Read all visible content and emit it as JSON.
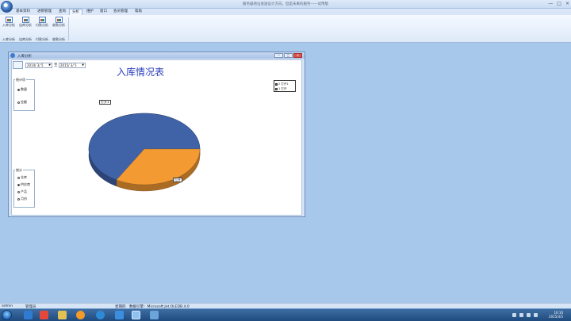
{
  "window": {
    "title": "服务器地址发送设计方向，但是未来的服务——试用版",
    "controls": [
      "—",
      "□",
      "×"
    ]
  },
  "menu": {
    "tabs": [
      {
        "label": "基本资料",
        "active": false
      },
      {
        "label": "进销管理",
        "active": false
      },
      {
        "label": "查询",
        "active": false
      },
      {
        "label": "分析",
        "active": true
      },
      {
        "label": "维护",
        "active": false
      },
      {
        "label": "窗口",
        "active": false
      },
      {
        "label": "会员管理",
        "active": false
      },
      {
        "label": "帮助",
        "active": false
      }
    ]
  },
  "ribbon": {
    "buttons": [
      {
        "icon": "chart-icon",
        "label": "入库分析",
        "foot": "入库分析"
      },
      {
        "icon": "chart-icon",
        "label": "出库分析",
        "foot": "出库分析"
      },
      {
        "icon": "chart-icon",
        "label": "付款分析",
        "foot": "付款分析"
      },
      {
        "icon": "chart-icon",
        "label": "收款分析",
        "foot": "收款分析"
      }
    ]
  },
  "child_window": {
    "title": "入库分析",
    "controls": [
      "—",
      "□",
      "×"
    ],
    "date_from": "2014/ 3/ 5",
    "date_to": "2015/ 3/ 5",
    "to_label": "至",
    "chart_title": "入库情况表",
    "group_stat": {
      "label": "统计项",
      "options": [
        {
          "label": "数量",
          "selected": true
        },
        {
          "label": "金额",
          "selected": false
        }
      ]
    },
    "group_by": {
      "label": "统计",
      "options": [
        {
          "label": "仓库",
          "selected": false
        },
        {
          "label": "供应商",
          "selected": true
        },
        {
          "label": "产品",
          "selected": false
        },
        {
          "label": "月份",
          "selected": false
        }
      ]
    },
    "legend": [
      {
        "label": "2 打开1",
        "color": "#4063a8"
      },
      {
        "label": "1 打开",
        "color": "#f39a33"
      }
    ],
    "slice_labels": [
      "打开1",
      "打开"
    ]
  },
  "chart_data": {
    "type": "pie",
    "title": "入库情况表",
    "categories": [
      "打开1",
      "打开"
    ],
    "values": [
      2,
      1
    ],
    "colors": [
      "#4063a8",
      "#f39a33"
    ],
    "legend_placement": "top-right"
  },
  "statusbar": {
    "user": "admin",
    "role": "管理员",
    "day": "星期四",
    "db_label": "数据引擎：Microsoft.Jet.OLEDB.4.0"
  },
  "taskbar": {
    "time": "10:10",
    "date": "2015/3/5"
  }
}
